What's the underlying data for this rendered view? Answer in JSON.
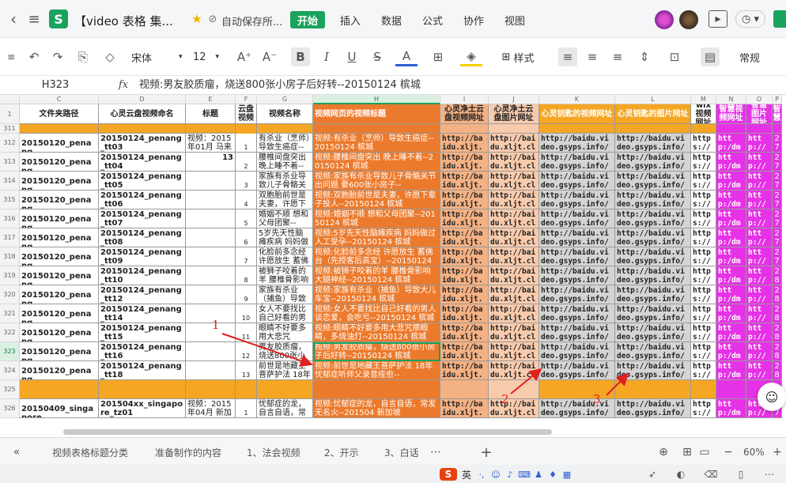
{
  "titlebar": {
    "doc_title": "【video 表格 集...",
    "autosave": "自动保存所...",
    "tabs": [
      "开始",
      "插入",
      "数据",
      "公式",
      "协作",
      "视图"
    ],
    "active_tab": "开始"
  },
  "toolbar": {
    "font_name": "宋体",
    "font_size": "12",
    "style_label": "样式",
    "number_format": "常规"
  },
  "formula_bar": {
    "cell_ref": "H323",
    "fx": "fx",
    "content": "视频:男友胶质瘤，烧送800张小房子后好转--20150124 槟城"
  },
  "grid": {
    "columns": [
      "C",
      "D",
      "E",
      "F",
      "G",
      "H",
      "I",
      "J",
      "K",
      "L",
      "M",
      "N",
      "O",
      "P"
    ],
    "selected_column": "H",
    "header_row": {
      "row_num": "1",
      "cells": [
        "文件夹路径",
        "心灵云盘视频命名",
        "标题",
        "云盘视频",
        "视频名称",
        "视频网页的视频标题",
        "心灵净土云盘视频网址",
        "心灵净土云盘图片网址",
        "心灵钥匙的视频网址",
        "心灵钥匙的图片网址",
        "wix视频网址",
        "智慧视频网址",
        "智慧图片网址",
        "智慧"
      ]
    },
    "rows": [
      {
        "num": "311",
        "cells": [
          "",
          "",
          "",
          "",
          "",
          "",
          "",
          "",
          "",
          "",
          "",
          "",
          "",
          ""
        ]
      },
      {
        "num": "312",
        "cells": [
          "20150120_penang",
          "20150124_penang_tt03",
          "视频：2015年01月 马来",
          "1",
          "有杀业（烹师）导致生癌症--",
          "视频:有杀业（烹师）导致生癌症--20150124 槟城",
          "http://baidu.xljt.clou",
          "http://baidu.xljt.clou",
          "http://baidu.video.gsyps.info/vid",
          "http://baidu.video.gsyps.info/vid",
          "https://vi",
          "http:/dmp4-",
          "http://rep",
          "27"
        ]
      },
      {
        "num": "313",
        "cells": [
          "20150120_penang",
          "20150124_penang_tt04",
          "13",
          "2",
          "腰椎间盘突出晚上睡不着--",
          "视频:腰椎间盘突出 晚上睡不着--20150124 槟城",
          "http://baidu.xljt.clou",
          "http://baidu.xljt.clou",
          "http://baidu.video.gsyps.info/vid",
          "http://baidu.video.gsyps.info/vid",
          "https://vi",
          "http:/dmp4-",
          "http://rep",
          "27"
        ]
      },
      {
        "num": "314",
        "cells": [
          "20150120_penang",
          "20150124_penang_tt05",
          "",
          "3",
          "家族有杀业导致儿子骨骼关",
          "视频:家族有杀业导致儿子骨骼关节出问题 要600张小房子--",
          "http://baidu.xljt.clou",
          "http://baidu.xljt.clou",
          "http://baidu.video.gsyps.info/vid",
          "http://baidu.video.gsyps.info/vid",
          "https://vi",
          "http:/dmp4-",
          "http://rep",
          "27"
        ]
      },
      {
        "num": "315",
        "cells": [
          "20150120_penang",
          "20150124_penang_tt06",
          "",
          "4",
          "双胞胎前世是夫妻，许愿下",
          "视频:双胞胎前世是夫妻，许愿下辈子投人--20150124 槟城",
          "http://baidu.xljt.clou",
          "http://baidu.xljt.clou",
          "http://baidu.video.gsyps.info/vid",
          "http://baidu.video.gsyps.info/vid",
          "https://vi",
          "http:/dmp4-",
          "http://rep",
          "27"
        ]
      },
      {
        "num": "316",
        "cells": [
          "20150120_penang",
          "20150124_penang_tt07",
          "",
          "5",
          "婚姻不顺 想和父母团聚--",
          "视频:婚姻不顺 想和父母团聚--20150124 槟城",
          "http://baidu.xljt.clou",
          "http://baidu.xljt.clou",
          "http://baidu.video.gsyps.info/vid",
          "http://baidu.video.gsyps.info/vid",
          "https://vi",
          "http:/dmp4-",
          "http://rep",
          "27"
        ]
      },
      {
        "num": "317",
        "cells": [
          "20150120_penang",
          "20150124_penang_tt08",
          "",
          "6",
          "5岁先天性脑瘫疾病 妈妈做过",
          "视频:5岁先天性脑瘫疾病 妈妈做过人工受孕--20150124 槟城",
          "http://baidu.xljt.clou",
          "http://baidu.xljt.clou",
          "http://baidu.video.gsyps.info/vid",
          "http://baidu.video.gsyps.info/vid",
          "https://vi",
          "http:/dmp4-",
          "http://rep",
          "27"
        ]
      },
      {
        "num": "318",
        "cells": [
          "20150120_penang",
          "20150124_penang_tt09",
          "",
          "7",
          "化脸前多念经 许愿放生 蓄佛",
          "视频:化脸前多念经 许愿放生 蓄佛台（先授客后高宝）--20150124",
          "http://baidu.xljt.clou",
          "http://baidu.xljt.clou",
          "http://baidu.video.gsyps.info/vid",
          "http://baidu.video.gsyps.info/vid",
          "https://vi",
          "http:/dmp4-",
          "http://rep",
          "27"
        ]
      },
      {
        "num": "319",
        "cells": [
          "20150120_penang",
          "20150124_penang_tt10",
          "",
          "8",
          "被狮子咬着的羊 腰椎骨影响",
          "视频:被狮子咬着的羊 腰椎骨影响大腿神经--20150124 槟城",
          "http://baidu.xljt.clou",
          "http://baidu.xljt.clou",
          "http://baidu.video.gsyps.info/vid",
          "http://baidu.video.gsyps.info/vid",
          "https://vi",
          "http:/dmp4-",
          "http://rep",
          "28"
        ]
      },
      {
        "num": "320",
        "cells": [
          "20150120_penang",
          "20150124_penang_tt12",
          "",
          "9",
          "家族有杀业（捕鱼）导致大",
          "视频:家族有杀业（捕鱼）导致大儿车宝--20150124 槟城",
          "http://baidu.xljt.clou",
          "http://baidu.xljt.clou",
          "http://baidu.video.gsyps.info/vid",
          "http://baidu.video.gsyps.info/vid",
          "https://vi",
          "http:/dmp4-",
          "http://rep",
          "28"
        ]
      },
      {
        "num": "321",
        "cells": [
          "20150120_penang",
          "20150124_penang_tt14",
          "",
          "10",
          "女人不要找比自己好看的男",
          "视频:女人不要找比自己好看的男人谈恋爱，会吃亏--20150124 槟城",
          "http://baidu.xljt.clou",
          "http://baidu.xljt.clou",
          "http://baidu.video.gsyps.info/vid",
          "http://baidu.video.gsyps.info/vid",
          "https://vi",
          "http:/dmp4-",
          "http://rep",
          "28"
        ]
      },
      {
        "num": "322",
        "cells": [
          "20150120_penang",
          "20150124_penang_tt15",
          "",
          "11",
          "眼睛不好要多用大悲咒",
          "视频:眼睛不好要多用大悲咒擦眼睛，多烧油灯--20150124 槟城",
          "http://baidu.xljt.clou",
          "http://baidu.xljt.clou",
          "http://baidu.video.gsyps.info/vid",
          "http://baidu.video.gsyps.info/vid",
          "https://vi",
          "http:/dmp4-",
          "http://rep",
          "28"
        ]
      },
      {
        "num": "323",
        "cells": [
          "20150120_penang",
          "20150124_penang_tt16",
          "",
          "12",
          "男友胶质瘤，烧送800张小房",
          "视频:男友胶质瘤，烧送800张小房子后好转--20150124 槟城",
          "http://baidu.xljt.clou",
          "http://baidu.xljt.clou",
          "http://baidu.video.gsyps.info/vid",
          "http://baidu.video.gsyps.info/vid",
          "https://vi",
          "http:/dmp4-",
          "http://rep",
          "28"
        ]
      },
      {
        "num": "324",
        "cells": [
          "20150120_penang",
          "20150124_penang_tt18",
          "",
          "13",
          "前世是地藏王菩萨护法 18年",
          "视频:前世是地藏王菩萨护法 18年忧郁症听师父录音痊愈--",
          "http://baidu.xljt.clou",
          "http://baidu.xljt.clou",
          "http://baidu.video.gsyps.info/vid",
          "http://baidu.video.gsyps.info/vid",
          "https://vi",
          "http:/dmp4-",
          "http://rep",
          "28"
        ]
      },
      {
        "num": "325",
        "cells": [
          "",
          "",
          "",
          "",
          "",
          "",
          "",
          "",
          "",
          "",
          "",
          "",
          "",
          ""
        ]
      },
      {
        "num": "326",
        "cells": [
          "20150409_singapore",
          "201504xx_singapore_tz01",
          "视频：2015年04月 新加",
          "1",
          "忧郁症的龙，自言自语，常",
          "视频:忧郁症的龙，自言自语，常发无名火--201504 新加坡",
          "http://baidu.xljt.clou",
          "http://baidu.xljt.clou",
          "http://baidu.video.gsyps.info/vid",
          "http://baidu.video.gsyps.info/vid",
          "https://vi",
          "http:/dmp4-",
          "http://rep",
          "27"
        ]
      }
    ],
    "selected_cell": "H323"
  },
  "annotations": [
    "1",
    "2",
    "3"
  ],
  "sheet_tabs": [
    "视频表格标题分类",
    "准备制作的内容",
    "1、法会视频",
    "2、开示",
    "3、白话"
  ],
  "status": {
    "zoom": "60%",
    "ime_label": "英"
  },
  "colors": {
    "brand_green": "#1aa35c",
    "orange_fill": "#f5a623",
    "deep_orange": "#ec7a2c",
    "salmon": "#f4b183",
    "peach": "#f8cbad",
    "magenta": "#e632e6",
    "annotation_red": "#e02020"
  }
}
